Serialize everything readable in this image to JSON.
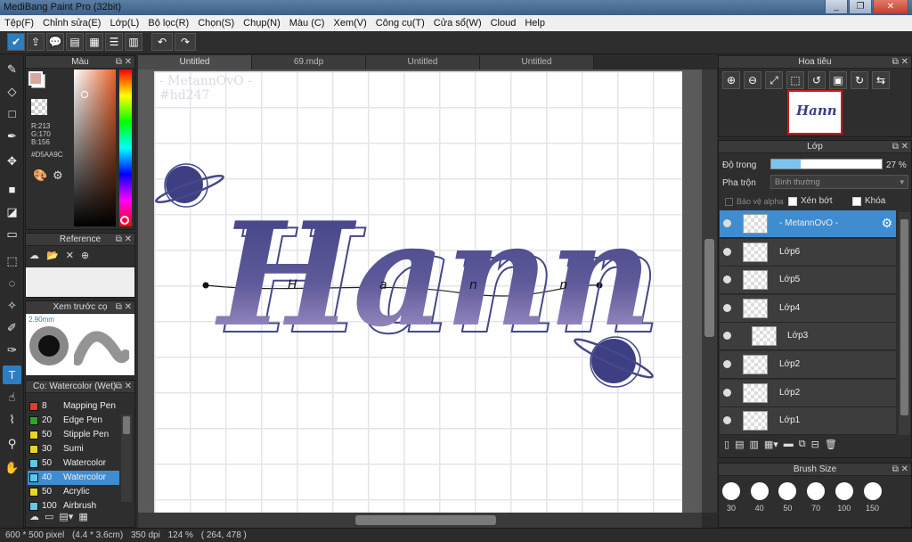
{
  "window": {
    "title": "MediBang Paint Pro (32bit)",
    "buttons": [
      "_",
      "❐",
      "✕"
    ]
  },
  "menu": [
    "Tệp(F)",
    "Chỉnh sửa(E)",
    "Lớp(L)",
    "Bộ lọc(R)",
    "Chọn(S)",
    "Chụp(N)",
    "Màu (C)",
    "Xem(V)",
    "Công cụ(T)",
    "Cửa sổ(W)",
    "Cloud",
    "Help"
  ],
  "tabs": [
    "Untitled",
    "69.mdp",
    "Untitled",
    "Untitled"
  ],
  "color_panel": {
    "title": "Màu",
    "r": "R:213",
    "g": "G:170",
    "b": "B:156",
    "hex": "#D5AA9C",
    "current_color": "#D5AA9C"
  },
  "reference_panel": {
    "title": "Reference"
  },
  "brush_preview": {
    "title": "Xem trước cọ",
    "size": "2.90mm"
  },
  "brush_list": {
    "title": "Cọ: Watercolor (Wet)",
    "items": [
      {
        "num": "8",
        "name": "Mapping Pen",
        "color": "#e03a2a"
      },
      {
        "num": "20",
        "name": "Edge Pen",
        "color": "#2da52d"
      },
      {
        "num": "50",
        "name": "Stipple Pen",
        "color": "#e8d52a"
      },
      {
        "num": "30",
        "name": "Sumi",
        "color": "#e8d52a"
      },
      {
        "num": "50",
        "name": "Watercolor",
        "color": "#5fc7e8"
      },
      {
        "num": "40",
        "name": "Watercolor",
        "color": "#5fc7e8"
      },
      {
        "num": "50",
        "name": "Acrylic",
        "color": "#e8d52a"
      },
      {
        "num": "100",
        "name": "Airbrush",
        "color": "#5fc7e8"
      }
    ]
  },
  "canvas": {
    "watermark_line1": "- MetannOvO -",
    "watermark_line2": "#hd247",
    "lettering": "Hann",
    "inner_word": "H a n n"
  },
  "navigator": {
    "title": "Hoa tiêu",
    "thumb_text": "Hann"
  },
  "layers": {
    "title": "Lớp",
    "opacity_label": "Độ trong",
    "opacity_value": "27 %",
    "opacity_fraction": 0.27,
    "blend_label": "Pha trộn",
    "blend_value": "Bình thường",
    "protect_alpha": "Bảo vệ alpha",
    "clipping": "Xén bớt",
    "lock": "Khóa",
    "items": [
      {
        "name": "- MetannOvO -",
        "selected": true
      },
      {
        "name": "Lớp6"
      },
      {
        "name": "Lớp5"
      },
      {
        "name": "Lớp4"
      },
      {
        "name": "Lớp3"
      },
      {
        "name": "Lớp2"
      },
      {
        "name": "Lớp2"
      },
      {
        "name": "Lớp1"
      }
    ]
  },
  "brush_size": {
    "title": "Brush Size",
    "sizes": [
      "30",
      "40",
      "50",
      "70",
      "100",
      "150"
    ]
  },
  "status": {
    "dimensions": "600 * 500 pixel",
    "cm": "(4.4 * 3.6cm)",
    "dpi": "350 dpi",
    "zoom": "124 %",
    "coords": "( 264, 478 )"
  }
}
